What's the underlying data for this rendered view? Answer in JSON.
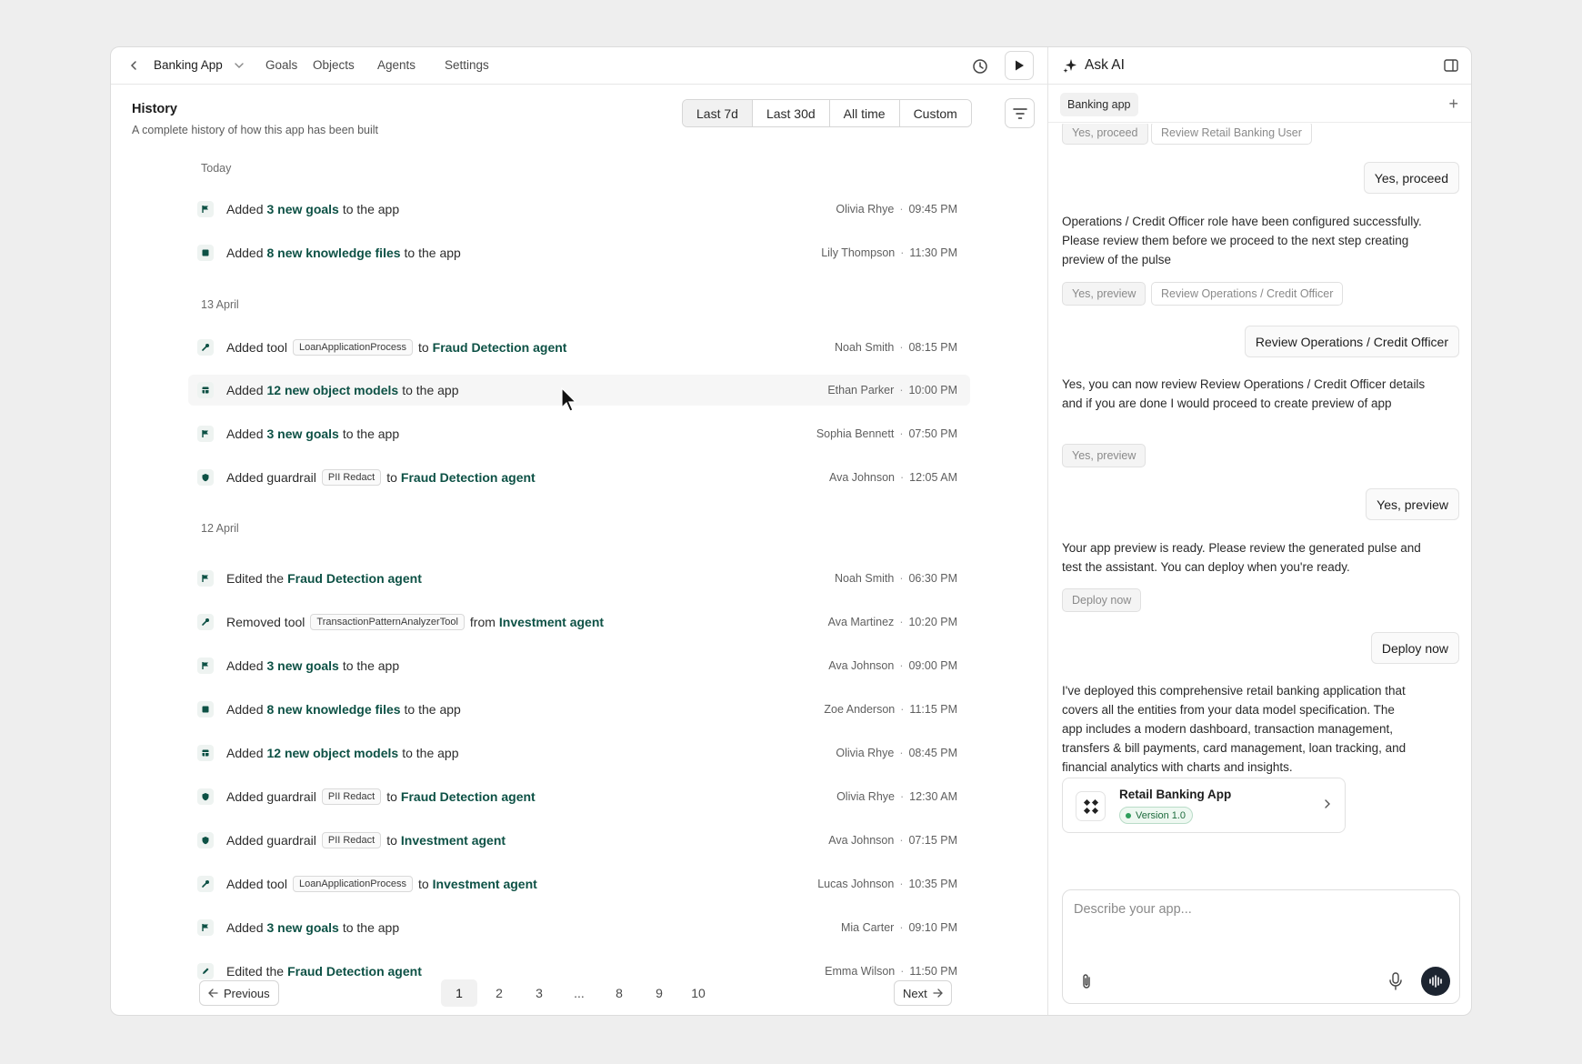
{
  "topbar": {
    "app_name": "Banking App",
    "nav": [
      "Goals",
      "Objects",
      "Agents",
      "Settings"
    ]
  },
  "history": {
    "title": "History",
    "subtitle": "A complete history of how this app has been built",
    "ranges": [
      "Last 7d",
      "Last 30d",
      "All time",
      "Custom"
    ],
    "active_range": "Last 7d"
  },
  "groups": [
    {
      "label": "Today"
    },
    {
      "label": "13 April"
    },
    {
      "label": "12 April"
    }
  ],
  "rows": [
    {
      "icon": "flag-icon",
      "pre": "Added",
      "link": "3 new goals",
      "tag": "",
      "link2": "",
      "mid": "",
      "post": "to the app",
      "user": "Olivia Rhye",
      "time": "09:45 PM"
    },
    {
      "icon": "book-icon",
      "pre": "Added",
      "link": "8 new knowledge files",
      "tag": "",
      "link2": "",
      "mid": "",
      "post": "to the app",
      "user": "Lily Thompson",
      "time": "11:30 PM"
    },
    {
      "icon": "wrench-icon",
      "pre": "Added tool",
      "link": "",
      "tag": "LoanApplicationProcess",
      "mid": "to",
      "link2": "Fraud Detection agent",
      "post": "",
      "user": "Noah Smith",
      "time": "08:15 PM"
    },
    {
      "icon": "table-icon",
      "pre": "Added",
      "link": "12 new object models",
      "tag": "",
      "link2": "",
      "mid": "",
      "post": "to the app",
      "user": "Ethan Parker",
      "time": "10:00 PM"
    },
    {
      "icon": "flag-icon",
      "pre": "Added",
      "link": "3 new goals",
      "tag": "",
      "link2": "",
      "mid": "",
      "post": "to the app",
      "user": "Sophia Bennett",
      "time": "07:50 PM"
    },
    {
      "icon": "shield-icon",
      "pre": "Added guardrail",
      "link": "",
      "tag": "PII Redact",
      "mid": "to",
      "link2": "Fraud Detection agent",
      "post": "",
      "user": "Ava Johnson",
      "time": "12:05 AM"
    },
    {
      "icon": "flag-icon",
      "pre": "Edited the",
      "link": "Fraud Detection agent",
      "tag": "",
      "link2": "",
      "mid": "",
      "post": "",
      "user": "Noah Smith",
      "time": "06:30 PM"
    },
    {
      "icon": "wrench-icon",
      "pre": "Removed tool",
      "link": "",
      "tag": "TransactionPatternAnalyzerTool",
      "mid": "from",
      "link2": "Investment agent",
      "post": "",
      "user": "Ava Martinez",
      "time": "10:20 PM"
    },
    {
      "icon": "flag-icon",
      "pre": "Added",
      "link": "3 new goals",
      "tag": "",
      "link2": "",
      "mid": "",
      "post": "to the app",
      "user": "Ava Johnson",
      "time": "09:00 PM"
    },
    {
      "icon": "book-icon",
      "pre": "Added",
      "link": "8 new knowledge files",
      "tag": "",
      "link2": "",
      "mid": "",
      "post": "to the app",
      "user": "Zoe Anderson",
      "time": "11:15 PM"
    },
    {
      "icon": "table-icon",
      "pre": "Added",
      "link": "12 new object models",
      "tag": "",
      "link2": "",
      "mid": "",
      "post": "to the app",
      "user": "Olivia Rhye",
      "time": "08:45 PM"
    },
    {
      "icon": "shield-icon",
      "pre": "Added guardrail",
      "link": "",
      "tag": "PII Redact",
      "mid": "to",
      "link2": "Fraud Detection agent",
      "post": "",
      "user": "Olivia Rhye",
      "time": "12:30 AM"
    },
    {
      "icon": "shield-icon",
      "pre": "Added guardrail",
      "link": "",
      "tag": "PII Redact",
      "mid": "to",
      "link2": "Investment agent",
      "post": "",
      "user": "Ava Johnson",
      "time": "07:15 PM"
    },
    {
      "icon": "wrench-icon",
      "pre": "Added tool",
      "link": "",
      "tag": "LoanApplicationProcess",
      "mid": "to",
      "link2": "Investment agent",
      "post": "",
      "user": "Lucas Johnson",
      "time": "10:35 PM"
    },
    {
      "icon": "flag-icon",
      "pre": "Added",
      "link": "3 new goals",
      "tag": "",
      "link2": "",
      "mid": "",
      "post": "to the app",
      "user": "Mia Carter",
      "time": "09:10 PM"
    },
    {
      "icon": "pencil-icon",
      "pre": "Edited the",
      "link": "Fraud Detection agent",
      "tag": "",
      "link2": "",
      "mid": "",
      "post": "",
      "user": "Emma Wilson",
      "time": "11:50 PM"
    }
  ],
  "pagination": {
    "previous": "Previous",
    "next": "Next",
    "pages": [
      "1",
      "2",
      "3",
      "...",
      "8",
      "9",
      "10"
    ],
    "current": "1"
  },
  "ai": {
    "title": "Ask AI",
    "chip": "Banking app",
    "chips_top": [
      "Yes, proceed",
      "Review Retail Banking User"
    ],
    "user_1": "Yes, proceed",
    "msg_1": "Operations / Credit Officer role have been configured successfully. Please review them before  we  proceed to the next step creating preview of the pulse",
    "chips_2": [
      "Yes, preview",
      "Review Operations / Credit Officer"
    ],
    "user_2": "Review Operations / Credit Officer",
    "msg_2": "Yes, you can now review Review Operations / Credit Officer details and if you are done I would proceed to create preview of app",
    "chips_3": [
      "Yes, preview"
    ],
    "user_3": "Yes, preview",
    "msg_3": "Your app preview is ready. Please review the generated pulse and test the assistant. You can deploy when you're ready.",
    "chips_4": [
      "Deploy now"
    ],
    "user_4": "Deploy now",
    "msg_4": "I've deployed this comprehensive retail banking application that covers all the entities from your data model specification. The app includes a modern dashboard, transaction management, transfers & bill payments, card management, loan tracking, and financial analytics with charts and insights.",
    "app_card": {
      "name": "Retail Banking App",
      "version": "Version 1.0"
    },
    "input_placeholder": "Describe your app..."
  },
  "colors": {
    "accent": "#0d5145",
    "dark_button": "#1c2430",
    "version_green": "#2e9e5b"
  }
}
